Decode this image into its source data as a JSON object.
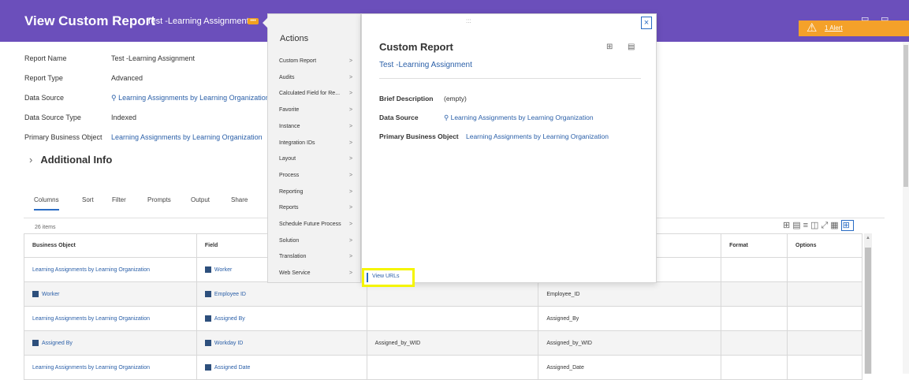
{
  "header": {
    "title": "View Custom Report",
    "subtitle": "Test -Learning Assignment",
    "tag": "•••",
    "alert": "1 Alert",
    "minimize": "▭",
    "restore": "▭"
  },
  "details": [
    {
      "key": "Report Name",
      "value": "Test -Learning Assignment",
      "link": false
    },
    {
      "key": "Report Type",
      "value": "Advanced",
      "link": false
    },
    {
      "key": "Data Source",
      "value": "⚲ Learning Assignments by Learning Organization",
      "link": true
    },
    {
      "key": "Data Source Type",
      "value": "Indexed",
      "link": false
    },
    {
      "key": "Primary Business Object",
      "value": "Learning Assignments by Learning Organization",
      "link": true
    }
  ],
  "additional_info": "Additional Info",
  "tabs": [
    "Columns",
    "Sort",
    "Filter",
    "Prompts",
    "Output",
    "Share"
  ],
  "items_count": "26 items",
  "table": {
    "headers": [
      "Business Object",
      "Field",
      "",
      "",
      "Format",
      "Options"
    ],
    "rows": [
      {
        "bo": "Learning Assignments by Learning Organization",
        "bo_icon": false,
        "field": "Worker",
        "c3": "",
        "c4": ""
      },
      {
        "bo": "Worker",
        "bo_icon": true,
        "field": "Employee ID",
        "c3": "",
        "c4": "Employee_ID"
      },
      {
        "bo": "Learning Assignments by Learning Organization",
        "bo_icon": false,
        "field": "Assigned By",
        "c3": "",
        "c4": "Assigned_By"
      },
      {
        "bo": "Assigned By",
        "bo_icon": true,
        "field": "Workday ID",
        "c3": "Assigned_by_WID",
        "c4": "Assigned_by_WID"
      },
      {
        "bo": "Learning Assignments by Learning Organization",
        "bo_icon": false,
        "field": "Assigned Date",
        "c3": "",
        "c4": "Assigned_Date"
      }
    ]
  },
  "actions_menu": {
    "title": "Actions",
    "items": [
      "Custom Report",
      "Audits",
      "Calculated Field for Re...",
      "Favorite",
      "Instance",
      "Integration IDs",
      "Layout",
      "Process",
      "Reporting",
      "Reports",
      "Schedule Future Process",
      "Solution",
      "Translation",
      "Web Service"
    ],
    "arrow": ">"
  },
  "popup": {
    "title": "Custom Report",
    "link": "Test -Learning Assignment",
    "grip": ":::",
    "close": "×",
    "rows": [
      {
        "key": "Brief Description",
        "value": "(empty)",
        "link": false
      },
      {
        "key": "Data Source",
        "value": "⚲ Learning Assignments by Learning Organization",
        "link": true
      },
      {
        "key": "Primary Business Object",
        "value": "Learning Assignments by Learning Organization",
        "link": true
      }
    ]
  },
  "submenu": {
    "item": "View URLs"
  },
  "colors": {
    "header": "#6b4fbb",
    "alert": "#f4a12a",
    "link": "#2a5fa8",
    "highlight": "#f5f500"
  }
}
